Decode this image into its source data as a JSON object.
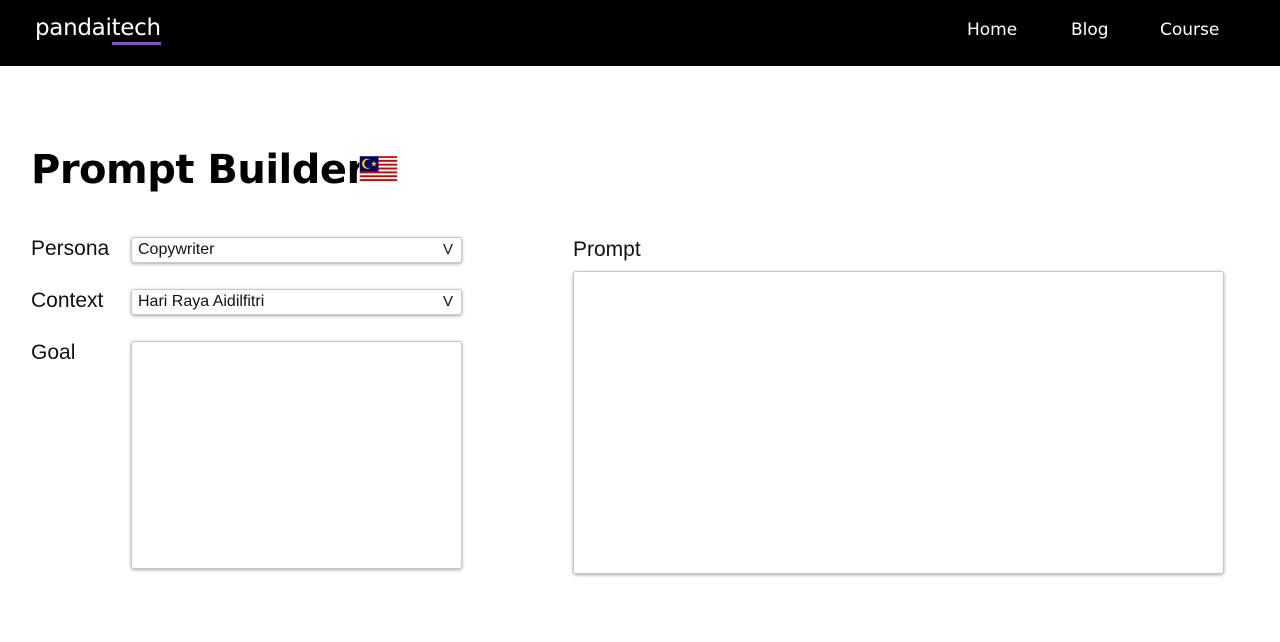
{
  "nav": {
    "logo_main": "pandai",
    "logo_accent": "tech",
    "links": [
      {
        "label": "Home"
      },
      {
        "label": "Blog"
      },
      {
        "label": "Course"
      }
    ]
  },
  "page": {
    "title": "Prompt Builder",
    "title_icon": "malaysia-flag-icon"
  },
  "form": {
    "persona": {
      "label": "Persona",
      "selected": "Copywriter"
    },
    "context": {
      "label": "Context",
      "selected": "Hari Raya Aidilfitri"
    },
    "goal": {
      "label": "Goal",
      "value": ""
    },
    "chevron": "V"
  },
  "prompt": {
    "label": "Prompt",
    "value": ""
  },
  "colors": {
    "navbar_bg": "#000000",
    "logo_underline": "#8a4fd8"
  }
}
